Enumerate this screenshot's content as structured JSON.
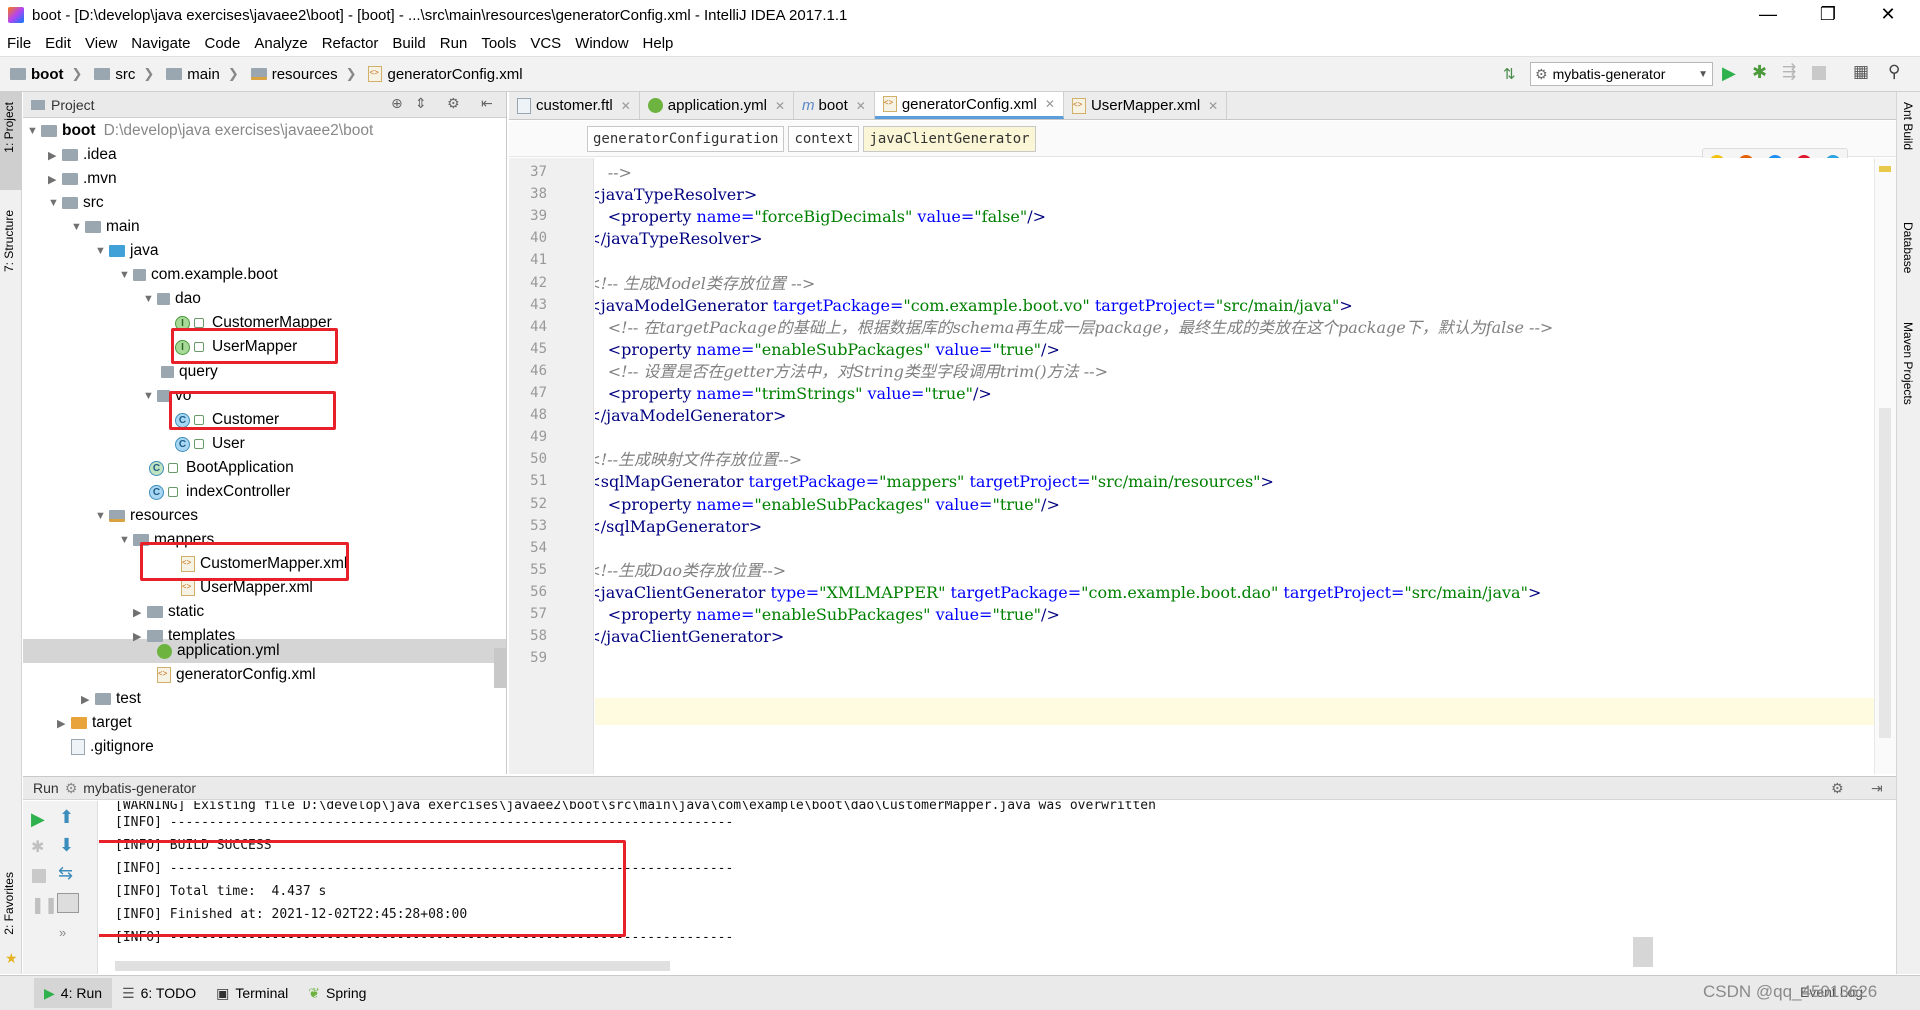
{
  "window": {
    "title": "boot - [D:\\develop\\java exercises\\javaee2\\boot] - [boot] - ...\\src\\main\\resources\\generatorConfig.xml - IntelliJ IDEA 2017.1.1",
    "min": "—",
    "max": "❐",
    "close": "✕"
  },
  "menu": [
    "File",
    "Edit",
    "View",
    "Navigate",
    "Code",
    "Analyze",
    "Refactor",
    "Build",
    "Run",
    "Tools",
    "VCS",
    "Window",
    "Help"
  ],
  "breadcrumb": [
    "boot",
    "src",
    "main",
    "resources",
    "generatorConfig.xml"
  ],
  "run_config": "mybatis-generator",
  "project_panel": {
    "title": "Project",
    "tree": [
      {
        "label": "boot",
        "path": "D:\\develop\\java exercises\\javaee2\\boot"
      },
      {
        "label": ".idea"
      },
      {
        "label": ".mvn"
      },
      {
        "label": "src"
      },
      {
        "label": "main"
      },
      {
        "label": "java"
      },
      {
        "label": "com.example.boot"
      },
      {
        "label": "dao"
      },
      {
        "label": "CustomerMapper"
      },
      {
        "label": "UserMapper"
      },
      {
        "label": "query"
      },
      {
        "label": "vo"
      },
      {
        "label": "Customer"
      },
      {
        "label": "User"
      },
      {
        "label": "BootApplication"
      },
      {
        "label": "indexController"
      },
      {
        "label": "resources"
      },
      {
        "label": "mappers"
      },
      {
        "label": "CustomerMapper.xml"
      },
      {
        "label": "UserMapper.xml"
      },
      {
        "label": "static"
      },
      {
        "label": "templates"
      },
      {
        "label": "application.yml"
      },
      {
        "label": "generatorConfig.xml"
      },
      {
        "label": "test"
      },
      {
        "label": "target"
      },
      {
        "label": ".gitignore"
      }
    ]
  },
  "editor_tabs": [
    {
      "label": "customer.ftl"
    },
    {
      "label": "application.yml"
    },
    {
      "label": "boot"
    },
    {
      "label": "generatorConfig.xml",
      "active": true
    },
    {
      "label": "UserMapper.xml"
    }
  ],
  "xml_breadcrumb": [
    "generatorConfiguration",
    "context",
    "javaClientGenerator"
  ],
  "code": {
    "line_numbers": [
      "37",
      "38",
      "39",
      "40",
      "41",
      "42",
      "43",
      "44",
      "45",
      "46",
      "47",
      "48",
      "49",
      "50",
      "51",
      "52",
      "53",
      "54",
      "55",
      "56",
      "57",
      "58",
      "59"
    ],
    "lines": [
      {
        "segments": [
          [
            "cm",
            "        -->"
          ]
        ]
      },
      {
        "segments": [
          [
            "tag",
            "    <javaTypeResolver>"
          ]
        ]
      },
      {
        "segments": [
          [
            "tag",
            "        <property "
          ],
          [
            "an",
            "name="
          ],
          [
            "av",
            "\"forceBigDecimals\""
          ],
          [
            "an",
            " value="
          ],
          [
            "av",
            "\"false\""
          ],
          [
            "tag",
            "/>"
          ]
        ]
      },
      {
        "segments": [
          [
            "tag",
            "    </javaTypeResolver>"
          ]
        ]
      },
      {
        "segments": [
          [
            "tag",
            ""
          ]
        ]
      },
      {
        "segments": [
          [
            "cm",
            "    <!-- 生成Model类存放位置 -->"
          ]
        ]
      },
      {
        "segments": [
          [
            "tag",
            "    <javaModelGenerator "
          ],
          [
            "an",
            "targetPackage="
          ],
          [
            "av",
            "\"com.example.boot.vo\""
          ],
          [
            "an",
            " targetProject="
          ],
          [
            "av",
            "\"src/main/java\""
          ],
          [
            "tag",
            ">"
          ]
        ]
      },
      {
        "segments": [
          [
            "cm",
            "        <!-- 在targetPackage的基础上，根据数据库的schema再生成一层package，最终生成的类放在这个package下，默认为false -->"
          ]
        ]
      },
      {
        "segments": [
          [
            "tag",
            "        <property "
          ],
          [
            "an",
            "name="
          ],
          [
            "av",
            "\"enableSubPackages\""
          ],
          [
            "an",
            " value="
          ],
          [
            "av",
            "\"true\""
          ],
          [
            "tag",
            "/>"
          ]
        ]
      },
      {
        "segments": [
          [
            "cm",
            "        <!-- 设置是否在getter方法中，对String类型字段调用trim()方法 -->"
          ]
        ]
      },
      {
        "segments": [
          [
            "tag",
            "        <property "
          ],
          [
            "an",
            "name="
          ],
          [
            "av",
            "\"trimStrings\""
          ],
          [
            "an",
            " value="
          ],
          [
            "av",
            "\"true\""
          ],
          [
            "tag",
            "/>"
          ]
        ]
      },
      {
        "segments": [
          [
            "tag",
            "    </javaModelGenerator>"
          ]
        ]
      },
      {
        "segments": [
          [
            "tag",
            ""
          ]
        ]
      },
      {
        "segments": [
          [
            "cm",
            "    <!--生成映射文件存放位置-->"
          ]
        ]
      },
      {
        "segments": [
          [
            "tag",
            "    <sqlMapGenerator "
          ],
          [
            "an",
            "targetPackage="
          ],
          [
            "av",
            "\"mappers\""
          ],
          [
            "an",
            " targetProject="
          ],
          [
            "av",
            "\"src/main/resources\""
          ],
          [
            "tag",
            ">"
          ]
        ]
      },
      {
        "segments": [
          [
            "tag",
            "        <property "
          ],
          [
            "an",
            "name="
          ],
          [
            "av",
            "\"enableSubPackages\""
          ],
          [
            "an",
            " value="
          ],
          [
            "av",
            "\"true\""
          ],
          [
            "tag",
            "/>"
          ]
        ]
      },
      {
        "segments": [
          [
            "tag",
            "    </sqlMapGenerator>"
          ]
        ]
      },
      {
        "segments": [
          [
            "tag",
            ""
          ]
        ]
      },
      {
        "segments": [
          [
            "cm",
            "    <!--生成Dao类存放位置-->"
          ]
        ]
      },
      {
        "segments": [
          [
            "tag",
            "    <javaClientGenerator "
          ],
          [
            "an",
            "type="
          ],
          [
            "av",
            "\"XMLMAPPER\""
          ],
          [
            "an",
            " targetPackage="
          ],
          [
            "av",
            "\"com.example.boot.dao\""
          ],
          [
            "an",
            " targetProject="
          ],
          [
            "av",
            "\"src/main/java\""
          ],
          [
            "tag",
            ">"
          ]
        ]
      },
      {
        "segments": [
          [
            "tag",
            "        <property "
          ],
          [
            "an",
            "name="
          ],
          [
            "av",
            "\"enableSubPackages\""
          ],
          [
            "an",
            " value="
          ],
          [
            "av",
            "\"true\""
          ],
          [
            "tag",
            "/>"
          ]
        ]
      },
      {
        "segments": [
          [
            "tag",
            "    </javaClientGenerator>"
          ]
        ]
      },
      {
        "segments": [
          [
            "tag",
            ""
          ]
        ]
      }
    ]
  },
  "run_panel": {
    "label": "Run",
    "config": "mybatis-generator",
    "console": [
      "[WARNING] Existing file D:\\develop\\java exercises\\javaee2\\boot\\src\\main\\java\\com\\example\\boot\\dao\\CustomerMapper.java was overwritten",
      "[INFO] ------------------------------------------------------------------------",
      "[INFO] BUILD SUCCESS",
      "[INFO] ------------------------------------------------------------------------",
      "[INFO] Total time:  4.437 s",
      "[INFO] Finished at: 2021-12-02T22:45:28+08:00",
      "[INFO] ------------------------------------------------------------------------"
    ]
  },
  "side_tabs": {
    "left": [
      "1: Project",
      "7: Structure",
      "2: Favorites"
    ],
    "right": [
      "Ant Build",
      "Database",
      "Maven Projects"
    ]
  },
  "bottom_tabs": [
    {
      "label": "4: Run",
      "active": true
    },
    {
      "label": "6: TODO"
    },
    {
      "label": "Terminal"
    },
    {
      "label": "Spring"
    }
  ],
  "status_right": "Event Log",
  "watermark": "CSDN @qq_45013626"
}
